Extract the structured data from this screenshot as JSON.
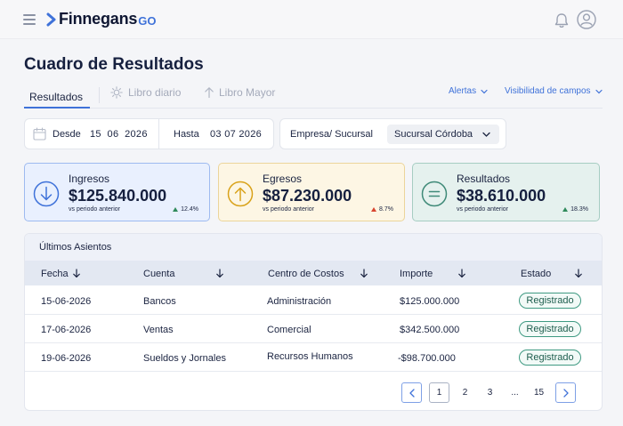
{
  "brand": {
    "name": "Finnegans",
    "suffix": "GO"
  },
  "page": {
    "title": "Cuadro de Resultados"
  },
  "tabs": [
    {
      "label": "Resultados"
    },
    {
      "label": "Libro diario"
    },
    {
      "label": "Libro Mayor"
    }
  ],
  "actions": {
    "alerts": "Alertas",
    "visibility": "Visibilidad de campos"
  },
  "filters": {
    "from_label": "Desde",
    "from_value": "15  06  2026",
    "to_label": "Hasta",
    "to_value": "03 07 2026",
    "company_label": "Empresa/ Sucursal",
    "company_value": "Sucursal Córdoba"
  },
  "kpis": [
    {
      "label": "Ingresos",
      "value": "$125.840.000",
      "sub": "vs periodo anterior",
      "delta": "12.4%",
      "color": "#3f72d9"
    },
    {
      "label": "Egresos",
      "value": "$87.230.000",
      "sub": "vs periodo anterior",
      "delta": "8.7%",
      "color": "#d9a21a"
    },
    {
      "label": "Resultados",
      "value": "$38.610.000",
      "sub": "vs periodo anterior",
      "delta": "18.3%",
      "color": "#3f8a78"
    }
  ],
  "table": {
    "title": "Últimos Asientos",
    "headers": [
      "Fecha",
      "Cuenta",
      "Centro de Costos",
      "Importe",
      "Estado"
    ],
    "rows": [
      [
        "15-06-2026",
        "Bancos",
        "Administración",
        "$125.000.000",
        "Registrado"
      ],
      [
        "17-06-2026",
        "Ventas",
        "Comercial",
        "$342.500.000",
        "Registrado"
      ],
      [
        "19-06-2026",
        "Sueldos y Jornales",
        "Recursos Humanos",
        "-$98.700.000",
        "Registrado"
      ]
    ]
  },
  "pagination": {
    "pages": [
      "1",
      "2",
      "3",
      "...",
      "15"
    ],
    "current": "1"
  },
  "colors": {
    "accent": "#3f72d9",
    "up_green": "#2f8a5b",
    "up_red": "#d8452f",
    "badge": "#3f9a82"
  }
}
